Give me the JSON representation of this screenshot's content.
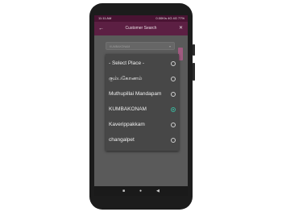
{
  "status_bar": {
    "time": "11:11 AM",
    "indicators": "0.00K/s 4G 4G 77%"
  },
  "app_bar": {
    "back_icon": "back-arrow-icon",
    "title": "Customer Search",
    "close_icon": "close-icon"
  },
  "background_field": {
    "value": "KUMBAKONAM"
  },
  "place_dialog": {
    "options": [
      {
        "label": "- Select Place -",
        "selected": false
      },
      {
        "label": "கும்பகோணம்",
        "selected": false
      },
      {
        "label": "Muthupillai Mandapam",
        "selected": false
      },
      {
        "label": "KUMBAKONAM",
        "selected": true
      },
      {
        "label": "Kaverippakkam",
        "selected": false
      },
      {
        "label": "changalpet",
        "selected": false
      }
    ]
  },
  "nav_bar": {
    "back": "◀",
    "home": "●",
    "recents": "■"
  },
  "colors": {
    "app_bar": "#5c1f43",
    "status_bar": "#4a1333",
    "radio_selected": "#3bb39a",
    "dialog": "#474747"
  }
}
